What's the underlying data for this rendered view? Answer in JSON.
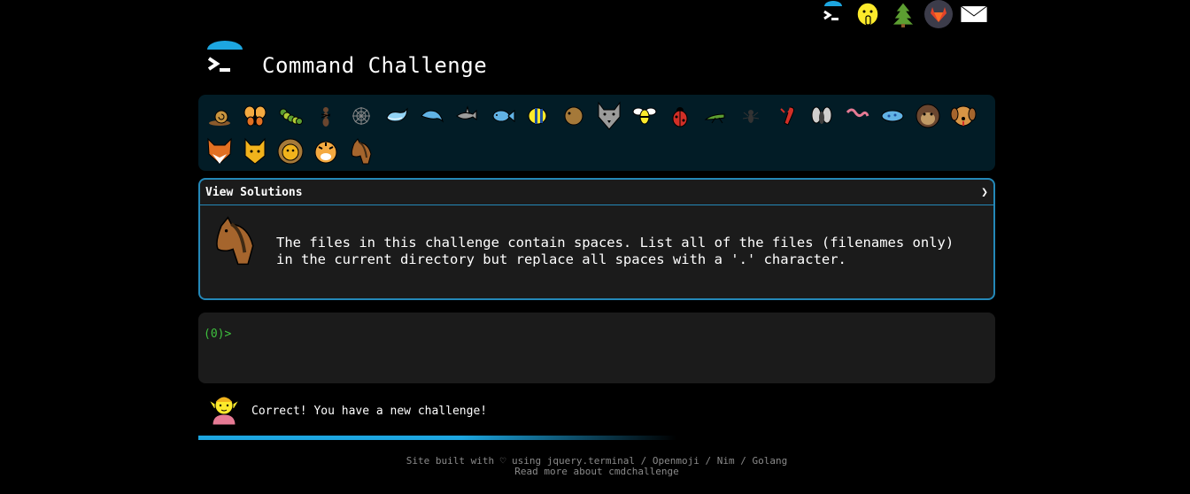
{
  "top_nav": {
    "items": [
      {
        "name": "terminal-logo-icon"
      },
      {
        "name": "shushing-face-icon"
      },
      {
        "name": "tree-icon"
      },
      {
        "name": "gitlab-icon"
      },
      {
        "name": "envelope-icon"
      }
    ]
  },
  "header": {
    "title": "Command Challenge"
  },
  "levels": {
    "row1": [
      "snail",
      "butterfly",
      "caterpillar",
      "ant",
      "spider-web",
      "whale",
      "dolphin",
      "shark",
      "fish",
      "tropical-fish",
      "blowfish",
      "wolf",
      "bee",
      "ladybug",
      "cricket",
      "spider",
      "scorpion",
      "fly",
      "worm",
      "microbe",
      "monkey",
      "dog"
    ],
    "row2": [
      "fox",
      "cat",
      "lion",
      "tiger",
      "horse"
    ]
  },
  "solutions": {
    "toggle_label": "View Solutions",
    "chevron": "❯",
    "challenge_icon": "horse-icon",
    "description": "The files in this challenge contain spaces. List all of the files (filenames only) in the current directory but replace all spaces with a '.' character."
  },
  "terminal": {
    "prompt": "(0)>"
  },
  "status": {
    "avatar": "elf-icon",
    "message": "Correct! You have a new challenge!",
    "progress_percent": 60
  },
  "footer": {
    "line1": "Site built with ♡ using jquery.terminal / Openmoji / Nim / Golang",
    "line2": "Read more about cmdchallenge"
  },
  "colors": {
    "accent": "#2488b8",
    "prompt": "#3ec13e",
    "panel": "#021c26",
    "progress": "#1da6e0"
  }
}
